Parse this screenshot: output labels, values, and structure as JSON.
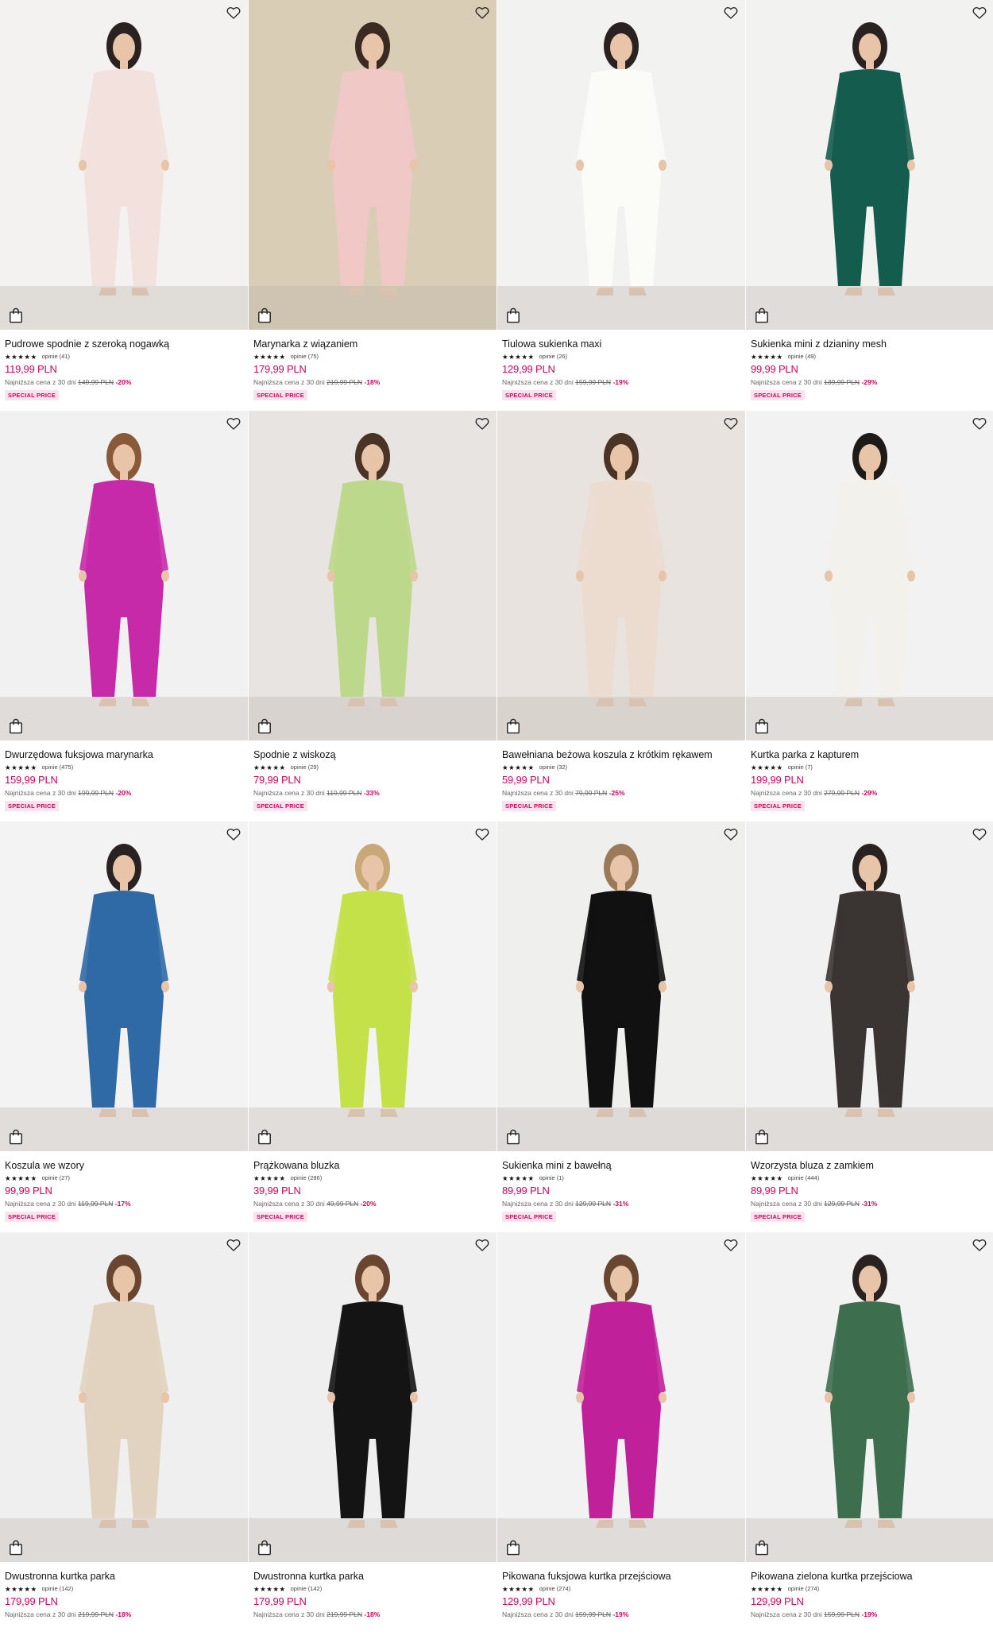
{
  "colors": {
    "price_accent": "#d1005b",
    "badge_bg": "#fbe3ee",
    "text": "#111111"
  },
  "icons": {
    "wishlist": "heart-outline-icon",
    "bag": "shopping-bag-icon",
    "star": "star-icon"
  },
  "products": [
    {
      "name": "Pudrowe spodnie z szeroką nogawką",
      "stars": "★★★★★",
      "rating": 4.5,
      "reviews": "opinie (41)",
      "price": "119,99 PLN",
      "lowest_label": "Najniższa cena z 30 dni",
      "old_price": "149,99 PLN",
      "discount": "-20%",
      "badge": "SPECIAL PRICE",
      "bg": "#f3f2f0",
      "garment": "#f3e1dd",
      "hair": "#2a2220"
    },
    {
      "name": "Marynarka z wiązaniem",
      "stars": "★★★★★",
      "rating": 4.5,
      "reviews": "opinie (75)",
      "price": "179,99 PLN",
      "lowest_label": "Najniższa cena z 30 dni",
      "old_price": "219,99 PLN",
      "discount": "-18%",
      "badge": "SPECIAL PRICE",
      "bg": "#d9cdb6",
      "garment": "#f0c8c6",
      "hair": "#3a2a22"
    },
    {
      "name": "Tiulowa sukienka maxi",
      "stars": "★★★★★",
      "rating": 4.5,
      "reviews": "opinie (26)",
      "price": "129,99 PLN",
      "lowest_label": "Najniższa cena z 30 dni",
      "old_price": "159,99 PLN",
      "discount": "-19%",
      "badge": "SPECIAL PRICE",
      "bg": "#f2f2f1",
      "garment": "#fbfbf8",
      "hair": "#2a2220"
    },
    {
      "name": "Sukienka mini z dzianiny mesh",
      "stars": "★★★★★",
      "rating": 4.5,
      "reviews": "opinie (49)",
      "price": "99,99 PLN",
      "lowest_label": "Najniższa cena z 30 dni",
      "old_price": "139,99 PLN",
      "discount": "-29%",
      "badge": "SPECIAL PRICE",
      "bg": "#f2f2f1",
      "garment": "#145c4e",
      "hair": "#2a2220"
    },
    {
      "name": "Dwurzędowa fuksjowa marynarka",
      "stars": "★★★★★",
      "rating": 4.5,
      "reviews": "opinie (475)",
      "price": "159,99 PLN",
      "lowest_label": "Najniższa cena z 30 dni",
      "old_price": "199,99 PLN",
      "discount": "-20%",
      "badge": "SPECIAL PRICE",
      "bg": "#f1f1f2",
      "garment": "#c72aa8",
      "hair": "#8a5a38"
    },
    {
      "name": "Spodnie z wiskozą",
      "stars": "★★★★★",
      "rating": 5,
      "reviews": "opinie (29)",
      "price": "79,99 PLN",
      "lowest_label": "Najniższa cena z 30 dni",
      "old_price": "119,99 PLN",
      "discount": "-33%",
      "badge": "SPECIAL PRICE",
      "bg": "#e7e4e2",
      "garment": "#bcd88a",
      "hair": "#4a3426"
    },
    {
      "name": "Bawełniana beżowa koszula z krótkim rękawem",
      "stars": "★★★★★",
      "rating": 4.5,
      "reviews": "opinie (32)",
      "price": "59,99 PLN",
      "lowest_label": "Najniższa cena z 30 dni",
      "old_price": "79,99 PLN",
      "discount": "-25%",
      "badge": "SPECIAL PRICE",
      "bg": "#e8e3df",
      "garment": "#ecdcd0",
      "hair": "#4a3426"
    },
    {
      "name": "Kurtka parka z kapturem",
      "stars": "★★★★★",
      "rating": 5,
      "reviews": "opinie (7)",
      "price": "199,99 PLN",
      "lowest_label": "Najniższa cena z 30 dni",
      "old_price": "279,99 PLN",
      "discount": "-29%",
      "badge": "SPECIAL PRICE",
      "bg": "#f2f2f2",
      "garment": "#f3f1ec",
      "hair": "#1e1a18"
    },
    {
      "name": "Koszula we wzory",
      "stars": "★★★★★",
      "rating": 5,
      "reviews": "opinie (27)",
      "price": "99,99 PLN",
      "lowest_label": "Najniższa cena z 30 dni",
      "old_price": "119,99 PLN",
      "discount": "-17%",
      "badge": "SPECIAL PRICE",
      "bg": "#f3f3f3",
      "garment": "#2f6aa6",
      "hair": "#2a2220"
    },
    {
      "name": "Prążkowana bluzka",
      "stars": "★★★★★",
      "rating": 5,
      "reviews": "opinie (286)",
      "price": "39,99 PLN",
      "lowest_label": "Najniższa cena z 30 dni",
      "old_price": "49,99 PLN",
      "discount": "-20%",
      "badge": "SPECIAL PRICE",
      "bg": "#f3f3f3",
      "garment": "#c4e14a",
      "hair": "#c9a776"
    },
    {
      "name": "Sukienka mini z bawełną",
      "stars": "★★★★★",
      "rating": 5,
      "reviews": "opinie (1)",
      "price": "89,99 PLN",
      "lowest_label": "Najniższa cena z 30 dni",
      "old_price": "129,99 PLN",
      "discount": "-31%",
      "badge": "SPECIAL PRICE",
      "bg": "#efefee",
      "garment": "#111111",
      "hair": "#9a7a58"
    },
    {
      "name": "Wzorzysta bluza z zamkiem",
      "stars": "★★★★★",
      "rating": 5,
      "reviews": "opinie (444)",
      "price": "89,99 PLN",
      "lowest_label": "Najniższa cena z 30 dni",
      "old_price": "129,99 PLN",
      "discount": "-31%",
      "badge": "SPECIAL PRICE",
      "bg": "#f1f1f1",
      "garment": "#3a3432",
      "hair": "#2a2220"
    },
    {
      "name": "Dwustronna kurtka parka",
      "stars": "★★★★★",
      "rating": 5,
      "reviews": "opinie (142)",
      "price": "179,99 PLN",
      "lowest_label": "Najniższa cena z 30 dni",
      "old_price": "219,99 PLN",
      "discount": "-18%",
      "badge": "",
      "bg": "#efefef",
      "garment": "#e2d3c0",
      "hair": "#6a4630"
    },
    {
      "name": "Dwustronna kurtka parka",
      "stars": "★★★★★",
      "rating": 5,
      "reviews": "opinie (142)",
      "price": "179,99 PLN",
      "lowest_label": "Najniższa cena z 30 dni",
      "old_price": "219,99 PLN",
      "discount": "-18%",
      "badge": "",
      "bg": "#efefef",
      "garment": "#141414",
      "hair": "#6a4630"
    },
    {
      "name": "Pikowana fuksjowa kurtka przejściowa",
      "stars": "★★★★★",
      "rating": 5,
      "reviews": "opinie (274)",
      "price": "129,99 PLN",
      "lowest_label": "Najniższa cena z 30 dni",
      "old_price": "159,99 PLN",
      "discount": "-19%",
      "badge": "",
      "bg": "#f2f2f2",
      "garment": "#c0219a",
      "hair": "#6a4630"
    },
    {
      "name": "Pikowana zielona kurtka przejściowa",
      "stars": "★★★★★",
      "rating": 5,
      "reviews": "opinie (274)",
      "price": "129,99 PLN",
      "lowest_label": "Najniższa cena z 30 dni",
      "old_price": "159,99 PLN",
      "discount": "-19%",
      "badge": "",
      "bg": "#f2f2f2",
      "garment": "#3d6e4e",
      "hair": "#2a2220"
    }
  ]
}
